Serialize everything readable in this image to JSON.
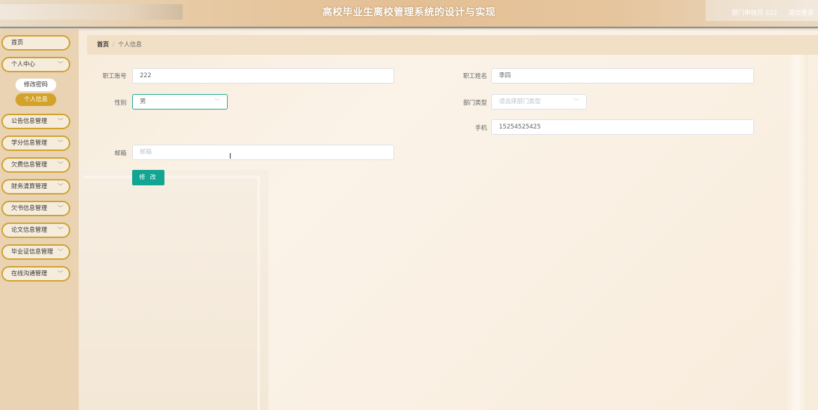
{
  "header": {
    "title": "高校毕业生离校管理系统的设计与实现",
    "user": "部门审核员 222",
    "logout": "退出登录"
  },
  "sidebar": {
    "items": [
      {
        "label": "首页",
        "has_chevron": false
      },
      {
        "label": "个人中心",
        "has_chevron": true
      },
      {
        "label": "公告信息管理",
        "has_chevron": true
      },
      {
        "label": "学分信息管理",
        "has_chevron": true
      },
      {
        "label": "欠费信息管理",
        "has_chevron": true
      },
      {
        "label": "财务清算管理",
        "has_chevron": true
      },
      {
        "label": "欠书信息管理",
        "has_chevron": true
      },
      {
        "label": "论文信息管理",
        "has_chevron": true
      },
      {
        "label": "毕业证信息管理",
        "has_chevron": true
      },
      {
        "label": "在线沟通管理",
        "has_chevron": true
      }
    ],
    "sub_items": [
      {
        "label": "修改密码",
        "active": false
      },
      {
        "label": "个人信息",
        "active": true
      }
    ]
  },
  "breadcrumb": {
    "home": "首页",
    "separator": "/",
    "current": "个人信息"
  },
  "form": {
    "account_label": "职工账号",
    "account_value": "222",
    "name_label": "职工姓名",
    "name_value": "李四",
    "gender_label": "性别",
    "gender_value": "男",
    "dept_label": "部门类型",
    "dept_placeholder": "请选择部门类型",
    "phone_label": "手机",
    "phone_value": "15254525425",
    "email_label": "邮箱",
    "email_placeholder": "邮箱",
    "submit_label": "修 改"
  },
  "colors": {
    "accent": "#12a591",
    "sidebar_border": "#cfa12e",
    "active_sub": "#d4a22b"
  },
  "icons": {
    "chevron": "chevron-down-icon",
    "cursor": "text-cursor-icon"
  }
}
